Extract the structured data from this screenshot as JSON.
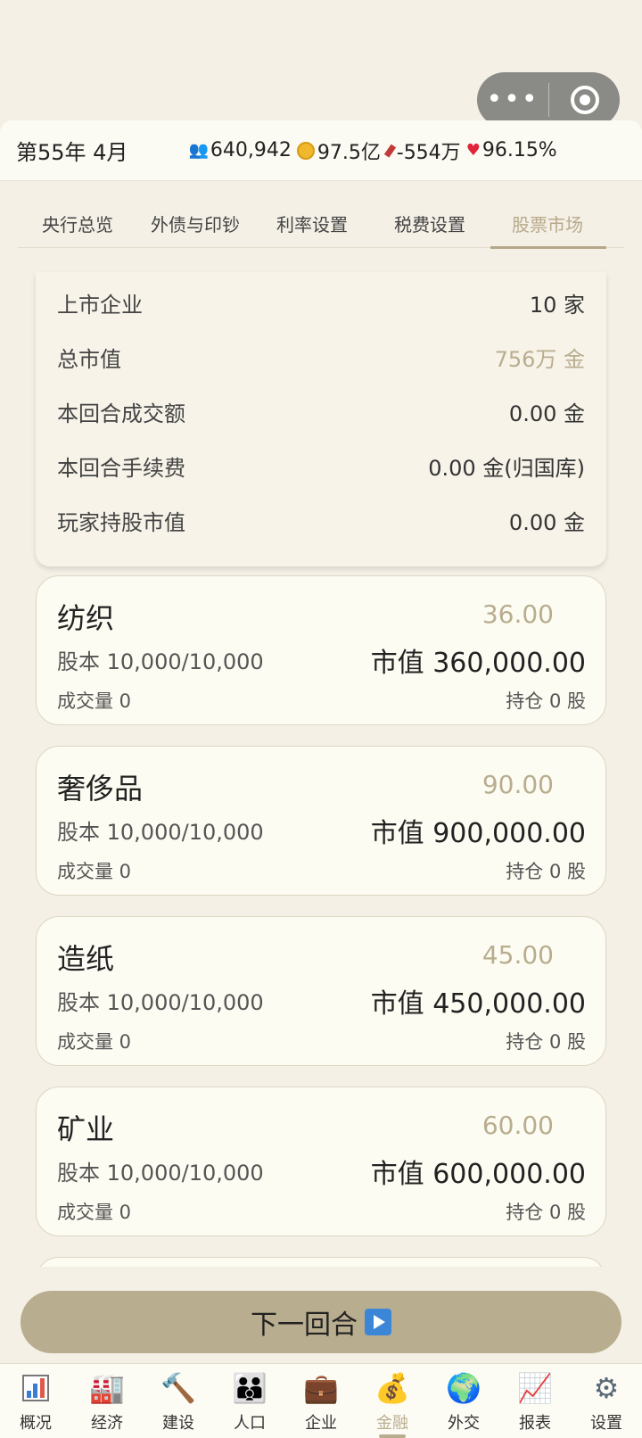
{
  "capsule": {
    "more_glyph": "•••"
  },
  "status": {
    "date": "第55年 4月",
    "population": "640,942",
    "treasury": "97.5亿",
    "deficit": "-554万",
    "approval": "96.15%"
  },
  "tabs": [
    {
      "label": "央行总览"
    },
    {
      "label": "外债与印钞"
    },
    {
      "label": "利率设置"
    },
    {
      "label": "税费设置"
    },
    {
      "label": "股票市场"
    }
  ],
  "summary": [
    {
      "label": "上市企业",
      "value": "10 家"
    },
    {
      "label": "总市值",
      "value": "756万 金"
    },
    {
      "label": "本回合成交额",
      "value": "0.00 金"
    },
    {
      "label": "本回合手续费",
      "value": "0.00 金(归国库)"
    },
    {
      "label": "玩家持股市值",
      "value": "0.00 金"
    }
  ],
  "stocks": [
    {
      "name": "纺织",
      "price": "36.00",
      "shares": "股本 10,000/10,000",
      "market_cap": "市值 360,000.00",
      "volume": "成交量 0",
      "holding": "持仓 0 股"
    },
    {
      "name": "奢侈品",
      "price": "90.00",
      "shares": "股本 10,000/10,000",
      "market_cap": "市值 900,000.00",
      "volume": "成交量 0",
      "holding": "持仓 0 股"
    },
    {
      "name": "造纸",
      "price": "45.00",
      "shares": "股本 10,000/10,000",
      "market_cap": "市值 450,000.00",
      "volume": "成交量 0",
      "holding": "持仓 0 股"
    },
    {
      "name": "矿业",
      "price": "60.00",
      "shares": "股本 10,000/10,000",
      "market_cap": "市值 600,000.00",
      "volume": "成交量 0",
      "holding": "持仓 0 股"
    }
  ],
  "next_turn": {
    "label": "下一回合"
  },
  "nav": [
    {
      "label": "概况",
      "icon": "chart-icon"
    },
    {
      "label": "经济",
      "icon": "factory-icon"
    },
    {
      "label": "建设",
      "icon": "hammer-icon"
    },
    {
      "label": "人口",
      "icon": "family-icon"
    },
    {
      "label": "企业",
      "icon": "briefcase-icon"
    },
    {
      "label": "金融",
      "icon": "money-bag-icon"
    },
    {
      "label": "外交",
      "icon": "globe-icon"
    },
    {
      "label": "报表",
      "icon": "report-icon"
    },
    {
      "label": "设置",
      "icon": "gear-icon"
    }
  ]
}
